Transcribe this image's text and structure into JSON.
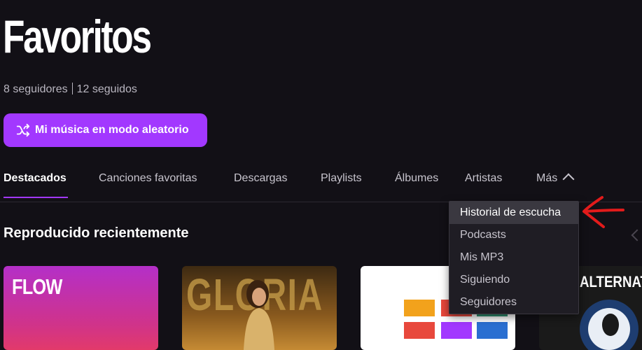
{
  "header": {
    "title": "Favoritos",
    "followers": "8 seguidores",
    "following": "12 seguidos"
  },
  "shuffle_button": {
    "label": "Mi música en modo aleatorio",
    "icon": "shuffle-icon"
  },
  "tabs": [
    {
      "label": "Destacados"
    },
    {
      "label": "Canciones favoritas"
    },
    {
      "label": "Descargas"
    },
    {
      "label": "Playlists"
    },
    {
      "label": "Álbumes"
    },
    {
      "label": "Artistas"
    },
    {
      "label": "Más"
    }
  ],
  "section": {
    "title": "Reproducido recientemente"
  },
  "cards": [
    {
      "label": "FLOW"
    },
    {
      "label": "GLORIA"
    },
    {
      "label": ""
    },
    {
      "label": "ALTERNATIV"
    }
  ],
  "dropdown": {
    "items": [
      {
        "label": "Historial de escucha"
      },
      {
        "label": "Podcasts"
      },
      {
        "label": "Mis MP3"
      },
      {
        "label": "Siguiendo"
      },
      {
        "label": "Seguidores"
      }
    ]
  },
  "colors": {
    "accent": "#a238ff",
    "background": "#121016",
    "annotation": "#e21b1b"
  }
}
